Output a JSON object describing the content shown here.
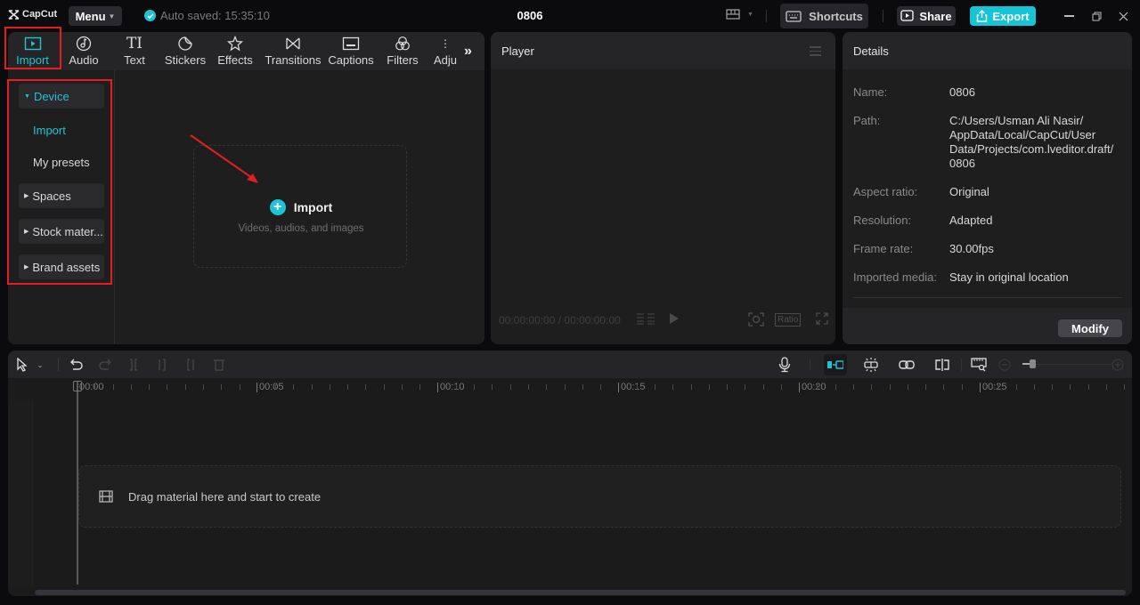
{
  "titlebar": {
    "app_name": "CapCut",
    "menu_label": "Menu",
    "autosave_text": "Auto saved: 15:35:10",
    "project_title": "0806",
    "shortcuts_label": "Shortcuts",
    "share_label": "Share",
    "export_label": "Export",
    "accent_color": "#15c5d6"
  },
  "media": {
    "tabs": [
      {
        "label": "Import",
        "icon": "import-icon",
        "active": true
      },
      {
        "label": "Audio",
        "icon": "audio-icon"
      },
      {
        "label": "Text",
        "icon": "text-icon"
      },
      {
        "label": "Stickers",
        "icon": "stickers-icon"
      },
      {
        "label": "Effects",
        "icon": "effects-icon"
      },
      {
        "label": "Transitions",
        "icon": "transitions-icon"
      },
      {
        "label": "Captions",
        "icon": "captions-icon"
      },
      {
        "label": "Filters",
        "icon": "filters-icon"
      },
      {
        "label": "Adju",
        "icon": "adjustment-icon"
      }
    ],
    "sidebar": {
      "device_label": "Device",
      "import_label": "Import",
      "presets_label": "My presets",
      "spaces_label": "Spaces",
      "stock_label": "Stock mater...",
      "brand_label": "Brand assets"
    },
    "import_card": {
      "title": "Import",
      "subtitle": "Videos, audios, and images"
    }
  },
  "player": {
    "title": "Player",
    "timecode": "00:00:00:00 / 00:00:00:00",
    "ratio_label": "Ratio"
  },
  "details": {
    "title": "Details",
    "rows": [
      {
        "label": "Name:",
        "value": "0806"
      },
      {
        "label": "Path:",
        "value": "C:/Users/Usman Ali Nasir/ AppData/Local/CapCut/User Data/Projects/com.lveditor.draft/ 0806"
      },
      {
        "label": "Aspect ratio:",
        "value": "Original"
      },
      {
        "label": "Resolution:",
        "value": "Adapted"
      },
      {
        "label": "Frame rate:",
        "value": "30.00fps"
      },
      {
        "label": "Imported media:",
        "value": "Stay in original location"
      }
    ],
    "modify_label": "Modify"
  },
  "timeline": {
    "ruler_labels": [
      "00:00",
      "00:05",
      "00:10",
      "00:15",
      "00:20",
      "00:25"
    ],
    "drop_text": "Drag material here and start to create"
  }
}
